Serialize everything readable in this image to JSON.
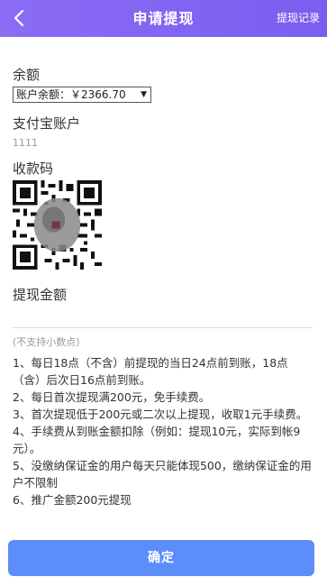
{
  "header": {
    "title": "申请提现",
    "records_link": "提现记录"
  },
  "balance": {
    "label": "余额",
    "select_value": "账户余额：￥2366.70"
  },
  "alipay": {
    "label": "支付宝账户",
    "value": "1111"
  },
  "qrcode": {
    "label": "收款码"
  },
  "amount": {
    "label": "提现金额",
    "hint": "(不支持小数点)"
  },
  "notes": [
    "1、每日18点（不含）前提现的当日24点前到账，18点（含）后次日16点前到账。",
    "2、每日首次提现满200元，免手续费。",
    "3、首次提现低于200元或二次以上提现，收取1元手续费。",
    "4、手续费从到账金额扣除（例如：提现10元，实际到帐9元）。",
    "5、没缴纳保证金的用户每天只能体现500，缴纳保证金的用户不限制",
    "6、推广金额200元提现"
  ],
  "confirm_button": "确定",
  "colors": {
    "header": "#8b6cf5",
    "button": "#5b8dfb"
  }
}
